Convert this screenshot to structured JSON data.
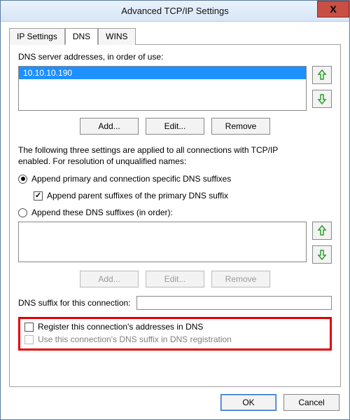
{
  "window": {
    "title": "Advanced TCP/IP Settings",
    "close_label": "X"
  },
  "tabs": {
    "ip_settings": "IP Settings",
    "dns": "DNS",
    "wins": "WINS"
  },
  "dns": {
    "servers_label": "DNS server addresses, in order of use:",
    "servers": [
      "10.10.10.190"
    ],
    "btn_add": "Add...",
    "btn_edit": "Edit...",
    "btn_remove": "Remove",
    "info_line1": "The following three settings are applied to all connections with TCP/IP",
    "info_line2": "enabled. For resolution of unqualified names:",
    "radio_primary": "Append primary and connection specific DNS suffixes",
    "check_parent": "Append parent suffixes of the primary DNS suffix",
    "radio_these": "Append these DNS suffixes (in order):",
    "btn_add2": "Add...",
    "btn_edit2": "Edit...",
    "btn_remove2": "Remove",
    "suffix_label": "DNS suffix for this connection:",
    "suffix_value": "",
    "check_register": "Register this connection's addresses in DNS",
    "check_use_suffix": "Use this connection's DNS suffix in DNS registration"
  },
  "footer": {
    "ok": "OK",
    "cancel": "Cancel"
  }
}
